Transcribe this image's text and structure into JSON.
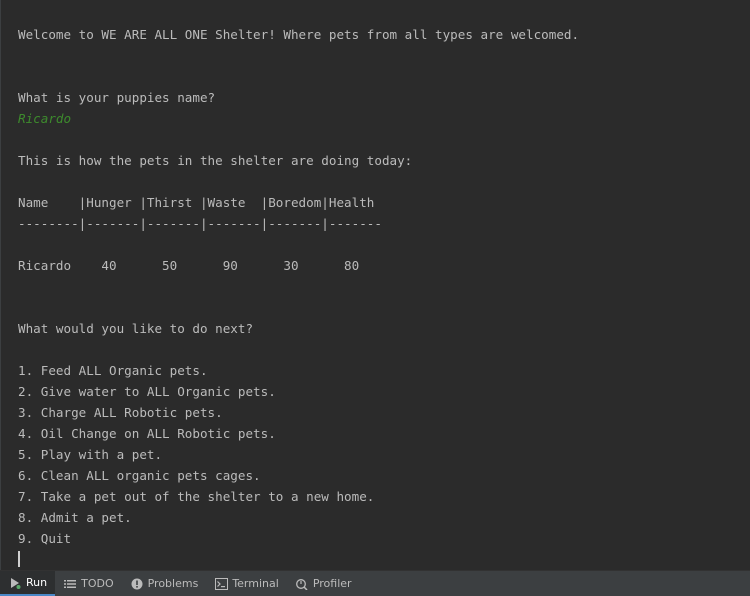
{
  "console": {
    "lines": {
      "welcome": "Welcome to WE ARE ALL ONE Shelter! Where pets from all types are welcomed.",
      "prompt_name": "What is your puppies name?",
      "input_name": "Ricardo",
      "status_intro": "This is how the pets in the shelter are doing today:",
      "table_header": "Name    |Hunger |Thirst |Waste  |Boredom|Health",
      "table_divider": "--------|-------|-------|-------|-------|-------",
      "table_row_1": "Ricardo    40      50      90      30      80",
      "next_prompt": "What would you like to do next?"
    },
    "menu": [
      "1. Feed ALL Organic pets.",
      "2. Give water to ALL Organic pets.",
      "3. Charge ALL Robotic pets.",
      "4. Oil Change on ALL Robotic pets.",
      "5. Play with a pet.",
      "6. Clean ALL organic pets cages.",
      "7. Take a pet out of the shelter to a new home.",
      "8. Admit a pet.",
      "9. Quit"
    ]
  },
  "toolbar": {
    "items": [
      {
        "label": "Run",
        "icon": "run-icon"
      },
      {
        "label": "TODO",
        "icon": "todo-list-icon"
      },
      {
        "label": "Problems",
        "icon": "problems-icon"
      },
      {
        "label": "Terminal",
        "icon": "terminal-icon"
      },
      {
        "label": "Profiler",
        "icon": "profiler-icon"
      }
    ]
  },
  "colors": {
    "background": "#2b2b2b",
    "text": "#bbbbbb",
    "user_input": "#3d8a2d",
    "toolbar": "#3c3f41"
  }
}
